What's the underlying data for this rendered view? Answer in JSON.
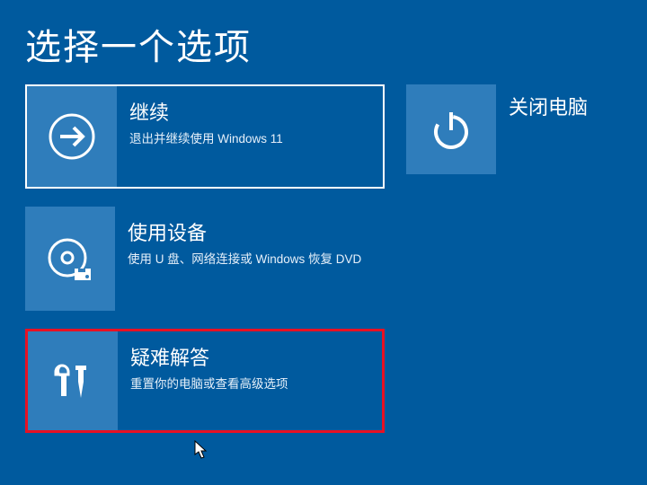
{
  "title": "选择一个选项",
  "tiles": {
    "continue": {
      "title": "继续",
      "subtitle": "退出并继续使用 Windows 11"
    },
    "device": {
      "title": "使用设备",
      "subtitle": "使用 U 盘、网络连接或 Windows 恢复 DVD"
    },
    "troubleshoot": {
      "title": "疑难解答",
      "subtitle": "重置你的电脑或查看高级选项"
    },
    "shutdown": {
      "label": "关闭电脑"
    }
  },
  "colors": {
    "background": "#005a9e",
    "tile": "#2f7dbb",
    "highlight": "#e81123"
  }
}
